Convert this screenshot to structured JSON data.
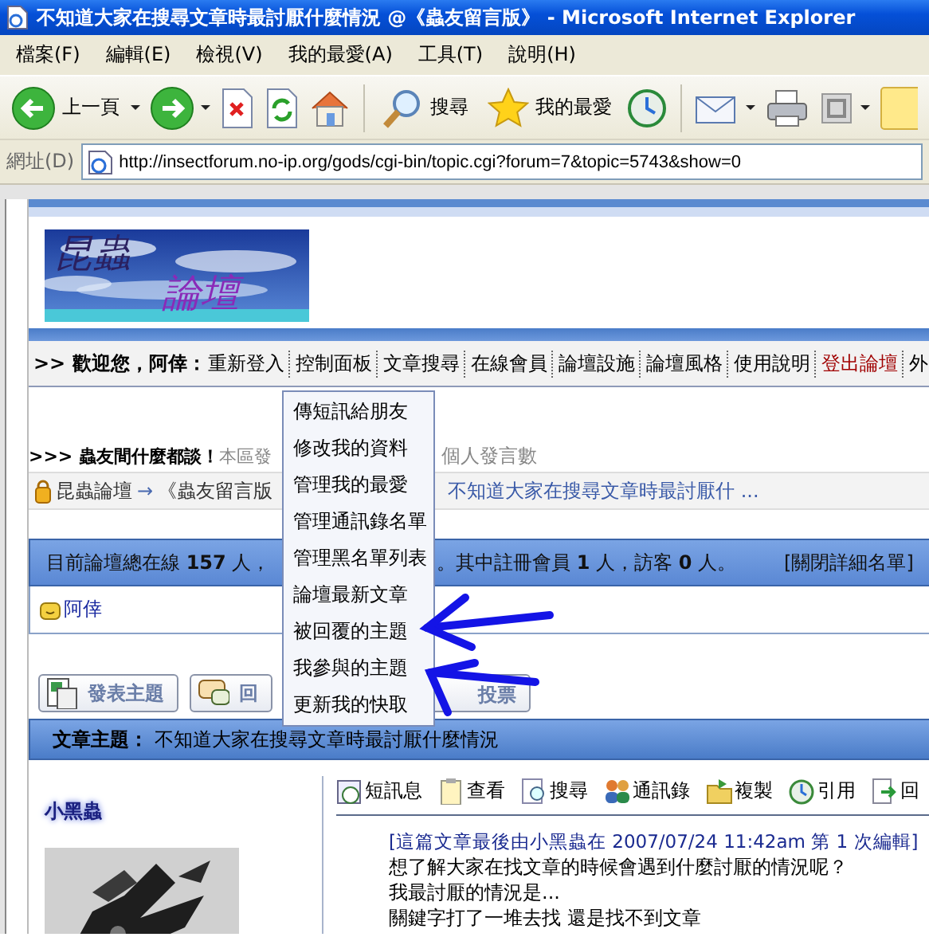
{
  "window": {
    "title": "不知道大家在搜尋文章時最討厭什麼情況 @《蟲友留言版》 - Microsoft Internet Explorer"
  },
  "menu_bar": [
    "檔案(F)",
    "編輯(E)",
    "檢視(V)",
    "我的最愛(A)",
    "工具(T)",
    "說明(H)"
  ],
  "toolbar": {
    "back_label": "上一頁",
    "search_label": "搜尋",
    "favorites_label": "我的最愛"
  },
  "address_bar": {
    "label": "網址(D)",
    "url": "http://insectforum.no-ip.org/gods/cgi-bin/topic.cgi?forum=7&topic=5743&show=0"
  },
  "forum": {
    "banner": {
      "lines": [
        "昆蟲",
        "論壇"
      ]
    },
    "nav": {
      "greeting": ">> 歡迎您，阿倖：",
      "links": [
        {
          "label": "重新登入",
          "kind": "normal"
        },
        {
          "label": "控制面板",
          "kind": "normal"
        },
        {
          "label": "文章搜尋",
          "kind": "normal"
        },
        {
          "label": "在線會員",
          "kind": "normal"
        },
        {
          "label": "論壇設施",
          "kind": "normal"
        },
        {
          "label": "論壇風格",
          "kind": "normal"
        },
        {
          "label": "使用說明",
          "kind": "normal"
        },
        {
          "label": "登出論壇",
          "kind": "logout"
        },
        {
          "label": "外",
          "kind": "normal"
        }
      ]
    },
    "board_line": {
      "title": ">>> 蟲友間什麼都談！",
      "stats": [
        "本區發",
        "個人發言數"
      ]
    },
    "breadcrumb": {
      "home": "昆蟲論壇",
      "arrow": "→",
      "board": "《蟲友留言版",
      "topic": "不知道大家在搜尋文章時最討厭什 ..."
    },
    "online": {
      "parts": [
        "目前論壇總在線 **157** 人，",
        "。其中註冊會員 **1** 人，訪客 **0** 人。"
      ],
      "toggle": "[關閉詳細名單]",
      "members": [
        "阿倖"
      ]
    },
    "buttons": [
      {
        "label": "發表主題",
        "kind": "new"
      },
      {
        "label": "回",
        "kind": "reply"
      },
      {
        "label": "投票",
        "kind": "poll"
      }
    ],
    "topic_bar": {
      "label": "文章主題：",
      "title": "不知道大家在搜尋文章時最討厭什麼情況"
    },
    "post": {
      "author": "小黑蟲",
      "actions": [
        {
          "label": "短訊息",
          "kind": "message"
        },
        {
          "label": "查看",
          "kind": "view"
        },
        {
          "label": "搜尋",
          "kind": "search"
        },
        {
          "label": "通訊錄",
          "kind": "contacts"
        },
        {
          "label": "複製",
          "kind": "copy"
        },
        {
          "label": "引用",
          "kind": "quote"
        },
        {
          "label": "回",
          "kind": "reply"
        }
      ],
      "edit_note": "[這篇文章最後由小黑蟲在 2007/07/24 11:42am 第 1 次編輯]",
      "lines": [
        "想了解大家在找文章的時候會遇到什麼討厭的情況呢？",
        "我最討厭的情況是...",
        "關鍵字打了一堆去找 還是找不到文章"
      ]
    }
  },
  "dropdown": {
    "items": [
      "傳短訊給朋友",
      "修改我的資料",
      "管理我的最愛",
      "管理通訊錄名單",
      "管理黑名單列表",
      "論壇最新文章",
      "被回覆的主題",
      "我參與的主題",
      "更新我的快取"
    ]
  }
}
